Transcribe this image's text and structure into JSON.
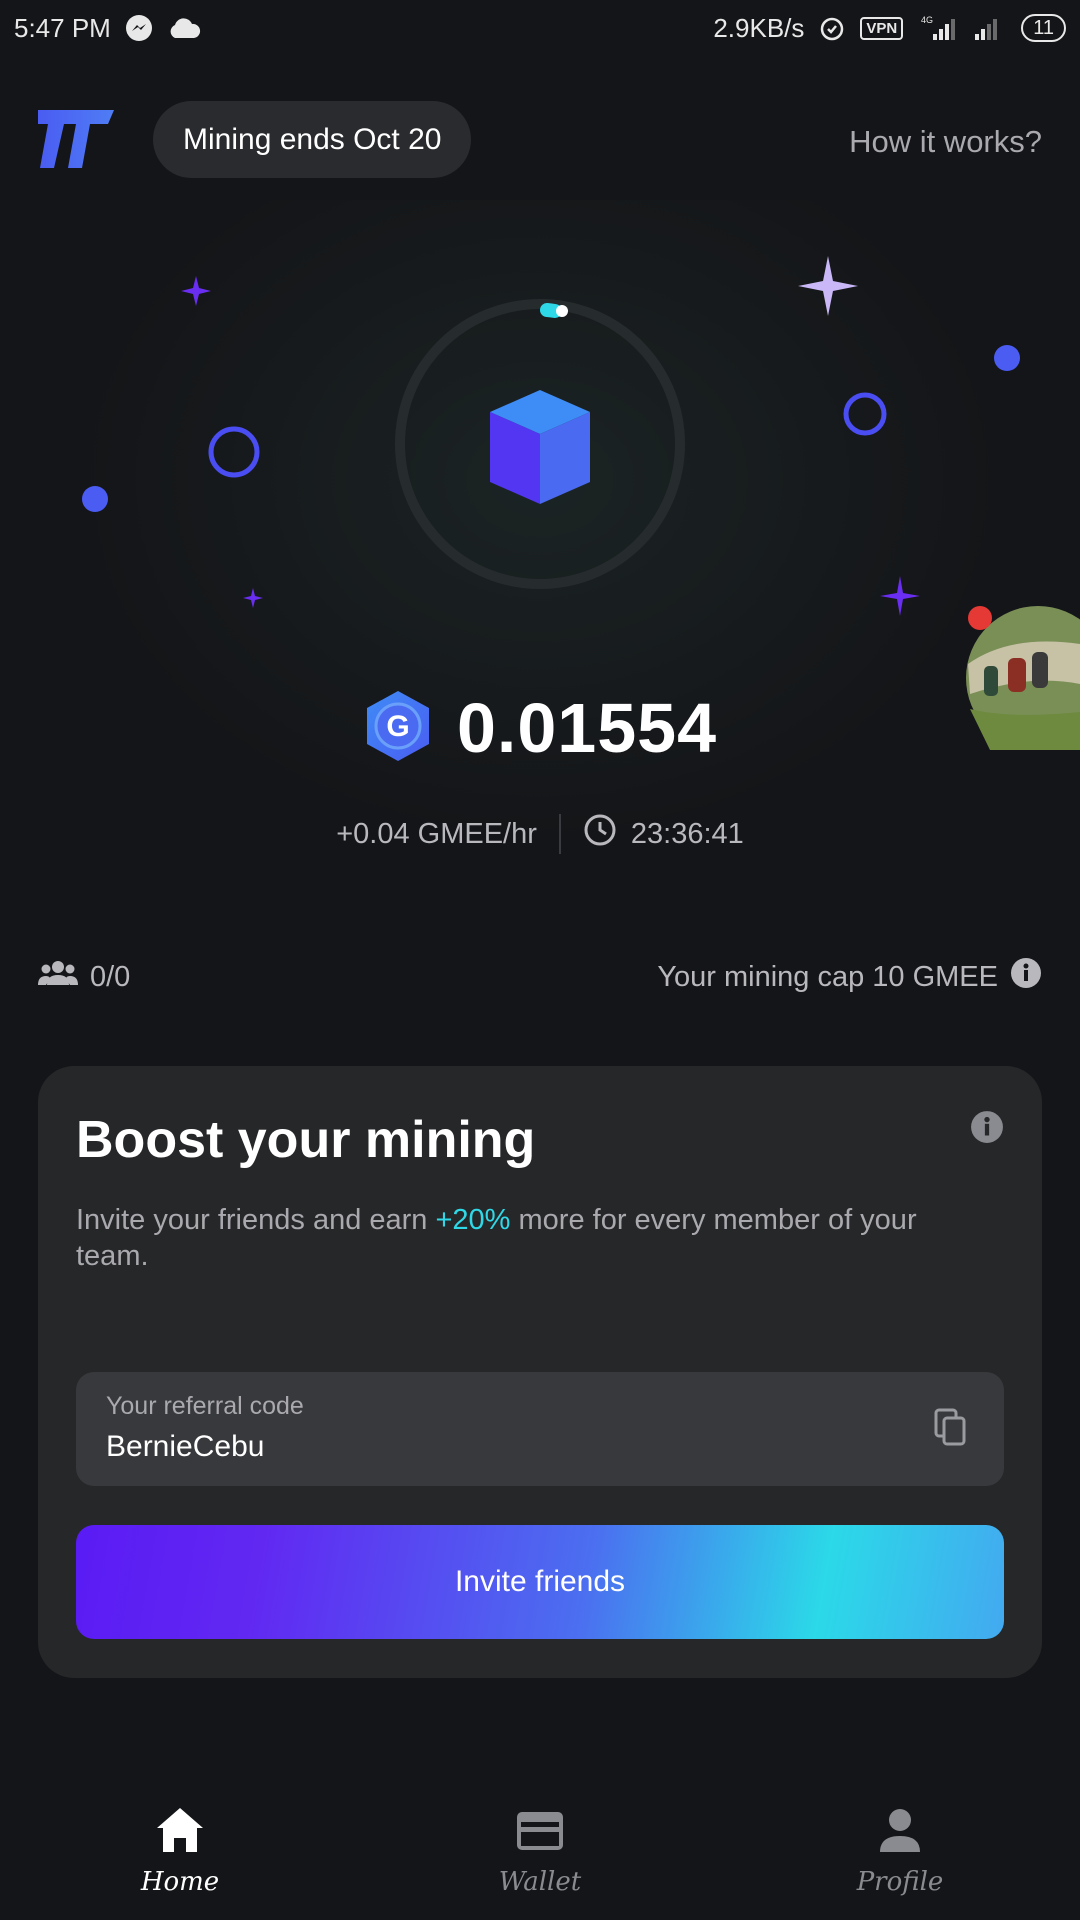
{
  "status_bar": {
    "time": "5:47 PM",
    "network_speed": "2.9KB/s",
    "vpn": "VPN",
    "network_type": "4G",
    "battery": "11",
    "icons": [
      "messenger-icon",
      "cloud-icon",
      "alarm-icon",
      "signal-icon",
      "signal-icon-2"
    ]
  },
  "header": {
    "mining_ends": "Mining ends Oct 20",
    "how_it_works": "How it works?"
  },
  "mining": {
    "balance": "0.01554",
    "rate": "+0.04 GMEE/hr",
    "timer": "23:36:41",
    "coin_letter": "G"
  },
  "team": {
    "count": "0/0",
    "cap": "Your mining cap 10 GMEE"
  },
  "boost": {
    "title": "Boost your mining",
    "desc_before": "Invite your friends and earn ",
    "desc_accent": "+20%",
    "desc_after": " more for every member of your team.",
    "referral_label": "Your referral code",
    "referral_code": "BernieCebu",
    "invite_label": "Invite friends"
  },
  "nav": {
    "items": [
      {
        "label": "Home",
        "icon": "home-icon",
        "active": true
      },
      {
        "label": "Wallet",
        "icon": "wallet-icon",
        "active": false
      },
      {
        "label": "Profile",
        "icon": "profile-icon",
        "active": false
      }
    ]
  },
  "colors": {
    "background": "#141518",
    "card": "#262729",
    "accent_cyan": "#2fd8e6",
    "accent_purple": "#5a1bf4",
    "cube_blue": "#3e8cf6"
  }
}
